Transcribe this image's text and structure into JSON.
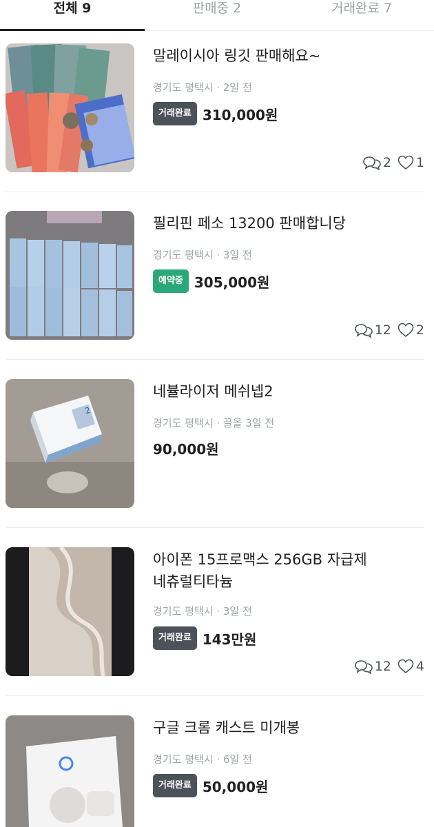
{
  "tabs": [
    {
      "label": "전체 9"
    },
    {
      "label": "판매중 2"
    },
    {
      "label": "거래완료 7"
    }
  ],
  "items": [
    {
      "title": "말레이시아 링깃 판매해요~",
      "meta": "경기도 평택시 · 2일 전",
      "badge": "거래완료",
      "price": "310,000원",
      "chats": "2",
      "likes": "1"
    },
    {
      "title": "필리핀 페소 13200 판매합니당",
      "meta": "경기도 평택시 · 3일 전",
      "badge": "예약중",
      "price": "305,000원",
      "chats": "12",
      "likes": "2"
    },
    {
      "title": "네뷸라이저 메쉬넵2",
      "meta": "경기도 평택시 · 끌올 3일 전",
      "badge": "",
      "price": "90,000원"
    },
    {
      "title_line1": "아이폰 15프로맥스 256GB 자급제",
      "title_line2": "네츄럴티타늄",
      "meta": "경기도 평택시 · 3일 전",
      "badge": "거래완료",
      "price": "143만원",
      "chats": "12",
      "likes": "4"
    },
    {
      "title": "구글 크롬 캐스트 미개봉",
      "meta": "경기도 평택시 · 6일 전",
      "badge": "거래완료",
      "price": "50,000원"
    }
  ],
  "colors": {
    "badge_done": "#4d5159",
    "badge_reserved": "#2ba87a",
    "meta_text": "#9ea3a8"
  },
  "icons": {
    "chat": "speech-bubbles-icon",
    "like": "heart-outline-icon"
  }
}
